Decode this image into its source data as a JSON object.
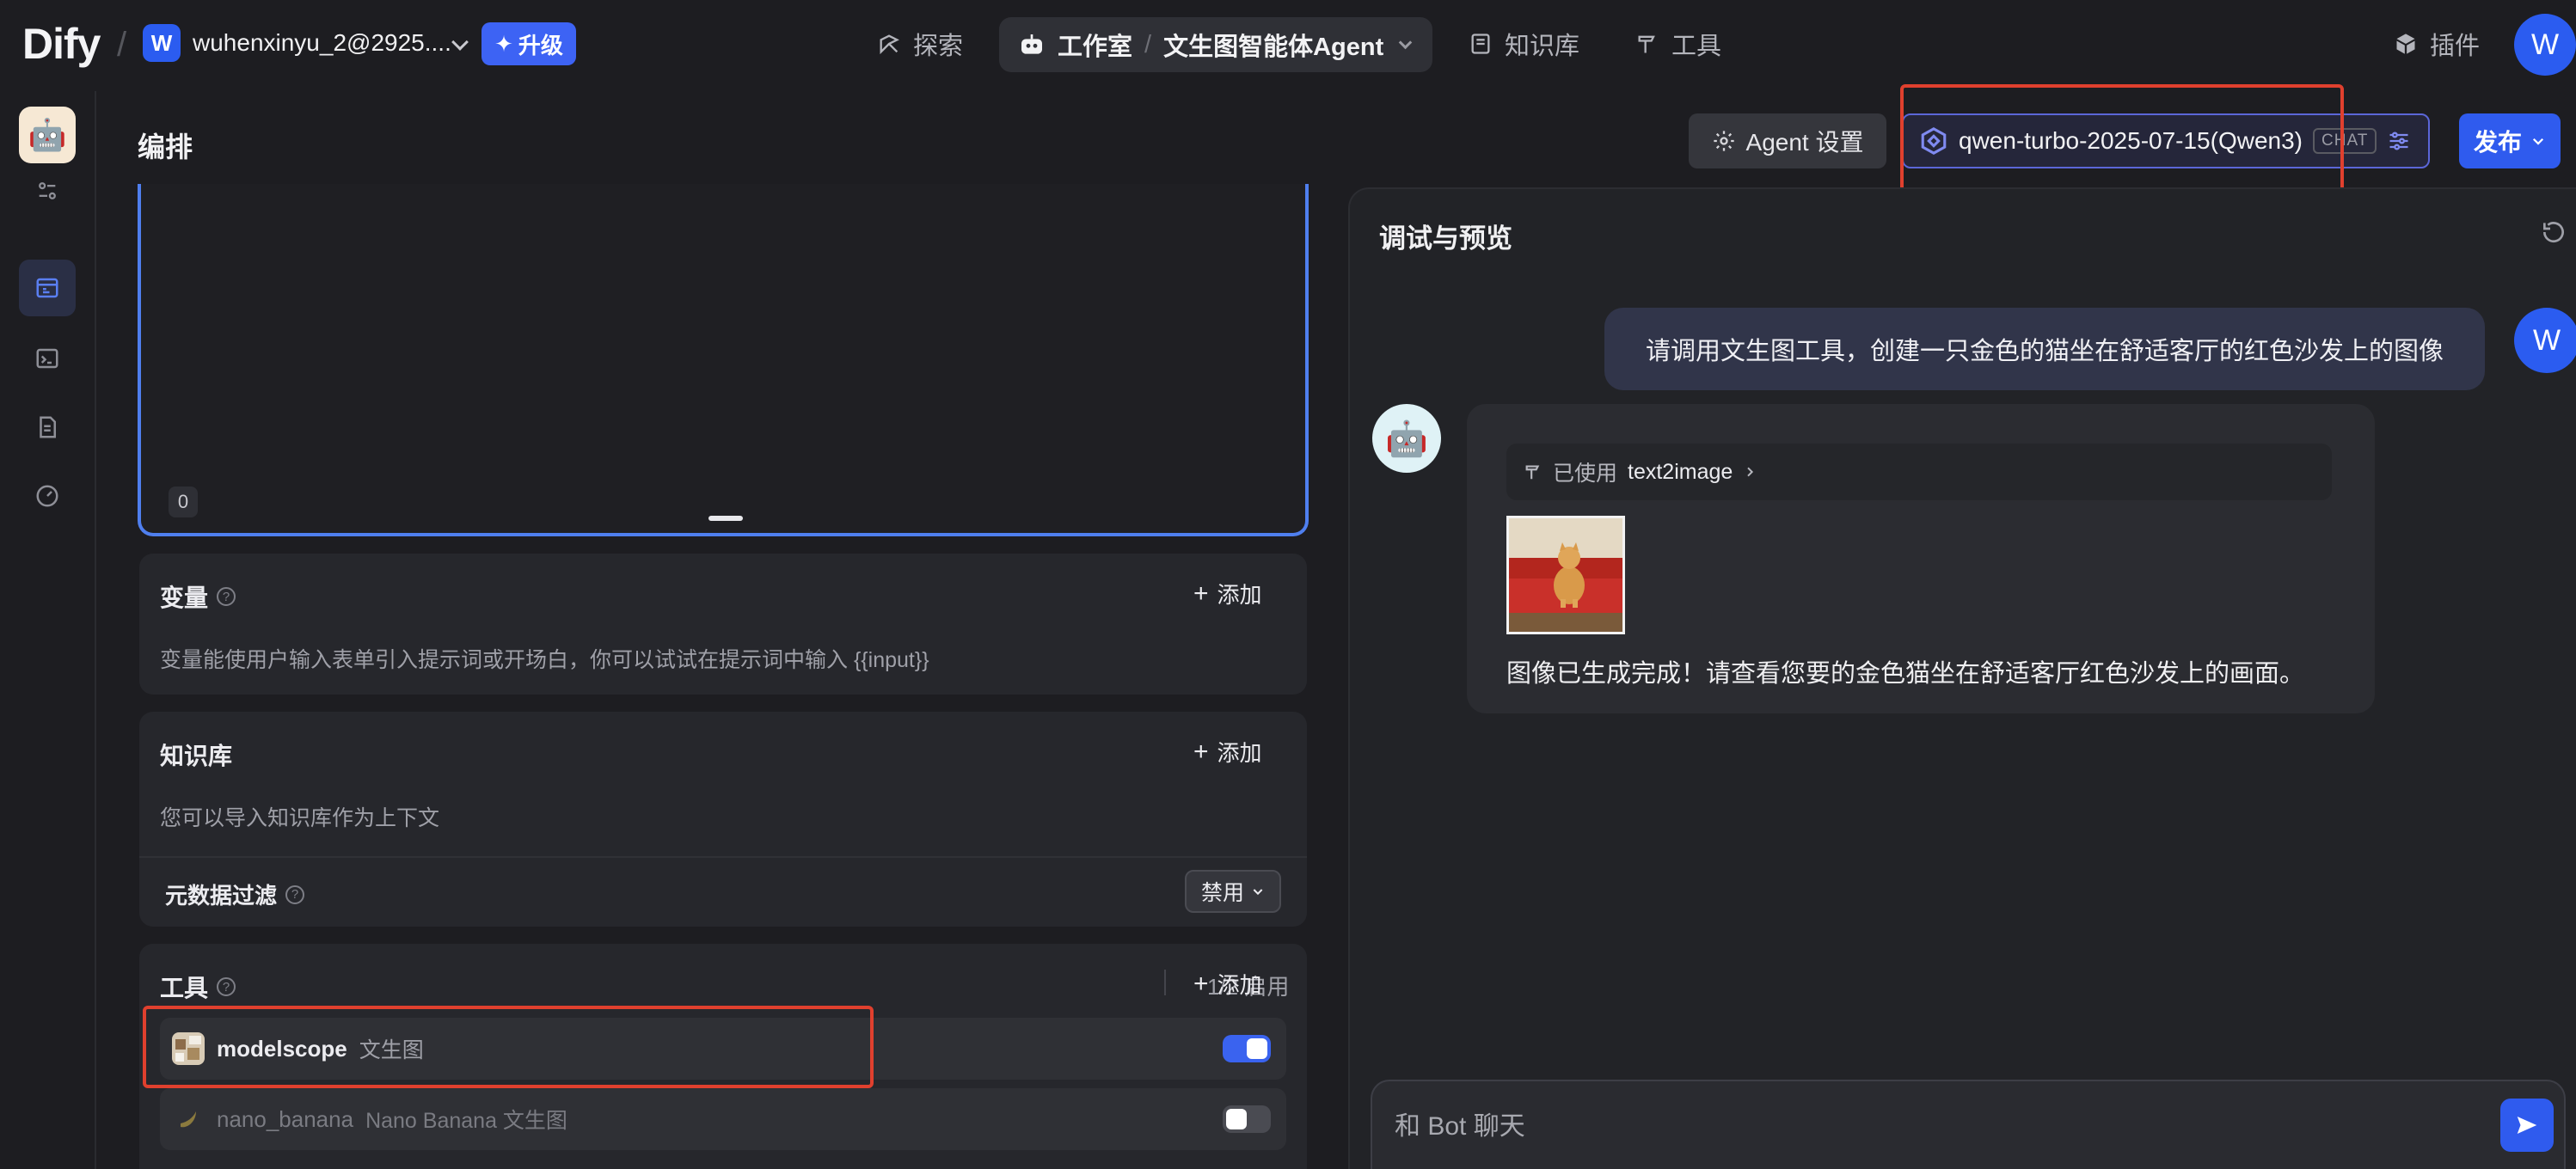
{
  "topbar": {
    "logo": "Dify",
    "workspace_initial": "W",
    "workspace_name": "wuhenxinyu_2@2925....",
    "upgrade_label": "升级",
    "nav": {
      "explore": "探索",
      "studio": "工作室",
      "app_name": "文生图智能体Agent",
      "knowledge": "知识库",
      "tools": "工具",
      "plugins": "插件"
    },
    "user_initial": "W"
  },
  "header": {
    "title": "编排",
    "agent_settings": "Agent 设置",
    "model_name": "qwen-turbo-2025-07-15(Qwen3)",
    "model_tag": "CHAT",
    "publish": "发布"
  },
  "prompt": {
    "char_count": "0"
  },
  "variables": {
    "title": "变量",
    "add": "添加",
    "description": "变量能使用户输入表单引入提示词或开场白，你可以试试在提示词中输入 {{input}}"
  },
  "knowledge": {
    "title": "知识库",
    "add": "添加",
    "description": "您可以导入知识库作为上下文",
    "metadata_filter": "元数据过滤",
    "metadata_value": "禁用"
  },
  "tools": {
    "title": "工具",
    "count": "1/2 启用",
    "add": "添加",
    "items": [
      {
        "name": "modelscope",
        "desc": "文生图",
        "enabled": true
      },
      {
        "name": "nano_banana",
        "desc": "Nano Banana 文生图",
        "enabled": false
      }
    ]
  },
  "debug": {
    "title": "调试与预览",
    "user_initial": "W",
    "user_message": "请调用文生图工具，创建一只金色的猫坐在舒适客厅的红色沙发上的图像",
    "used_prefix": "已使用",
    "used_tool": "text2image",
    "bot_message": "图像已生成完成！请查看您要的金色猫坐在舒适客厅红色沙发上的画面。",
    "input_placeholder": "和 Bot 聊天"
  },
  "colors": {
    "accent": "#2f5bee",
    "highlight_box": "#e0402e",
    "background": "#1d1d21"
  }
}
